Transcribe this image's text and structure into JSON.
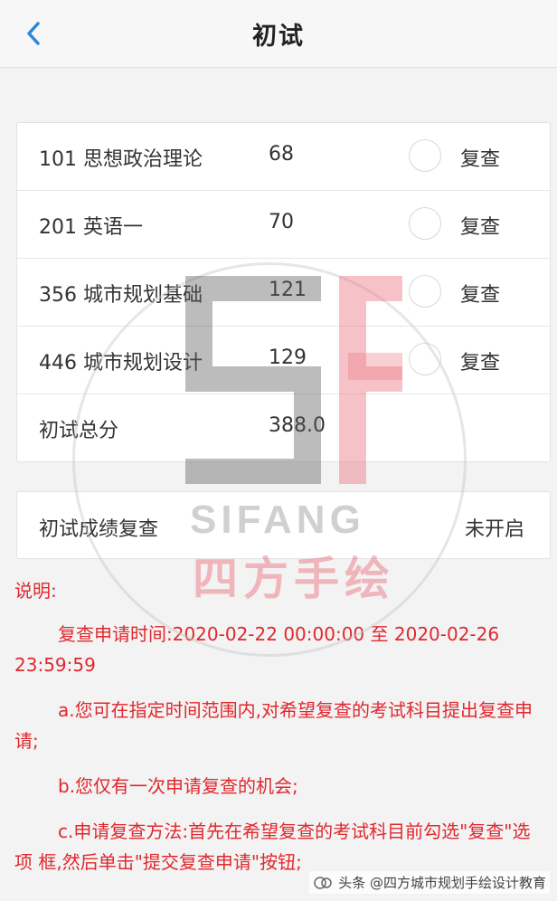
{
  "header": {
    "title": "初试"
  },
  "scores": [
    {
      "subject": "101 思想政治理论",
      "score": "68",
      "check_label": "复查"
    },
    {
      "subject": "201 英语一",
      "score": "70",
      "check_label": "复查"
    },
    {
      "subject": "356 城市规划基础",
      "score": "121",
      "check_label": "复查"
    },
    {
      "subject": "446 城市规划设计",
      "score": "129",
      "check_label": "复查"
    }
  ],
  "total": {
    "label": "初试总分",
    "value": "388.0"
  },
  "review": {
    "label": "初试成绩复查",
    "status": "未开启"
  },
  "notes": {
    "heading": "说明:",
    "p1": "复查申请时间:2020-02-22 00:00:00 至 2020-02-26 23:59:59",
    "p2": "a.您可在指定时间范围内,对希望复查的考试科目提出复查申请;",
    "p3": "b.您仅有一次申请复查的机会;",
    "p4": "c.申请复查方法:首先在希望复查的考试科目前勾选\"复查\"选项 框,然后单击\"提交复查申请\"按钮;"
  },
  "watermark": {
    "brand": "SIFANG",
    "brand_cn": "四方手绘",
    "footer": "头条 @四方城市规划手绘设计教育"
  },
  "colors": {
    "accent_blue": "#2f86d6",
    "note_red": "#e0282e"
  }
}
